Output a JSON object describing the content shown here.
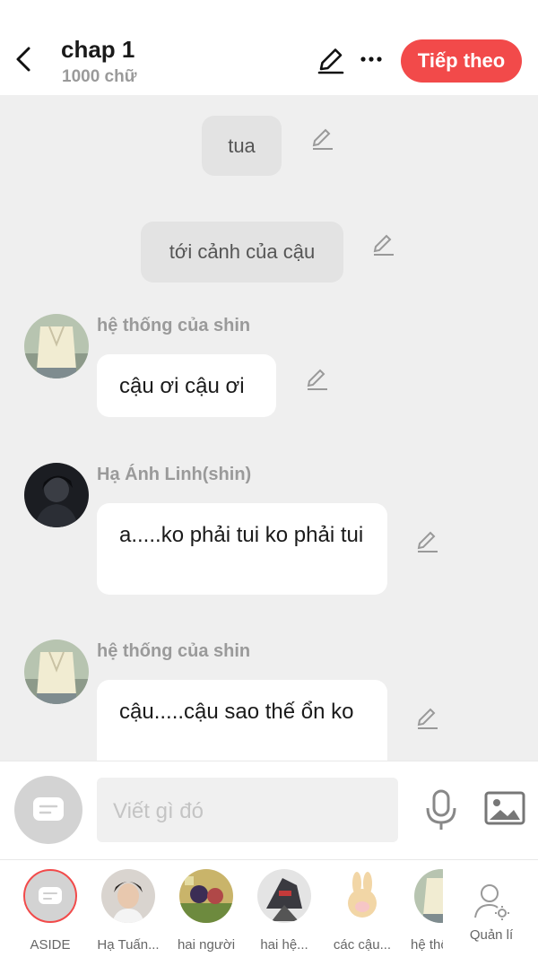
{
  "header": {
    "title": "chap 1",
    "subtitle": "1000 chữ",
    "next_label": "Tiếp theo"
  },
  "messages": [
    {
      "type": "narration",
      "text": "tua"
    },
    {
      "type": "narration",
      "text": "tới cảnh của cậu"
    },
    {
      "type": "message",
      "sender": "hệ thống của shin",
      "text": "cậu ơi cậu ơi"
    },
    {
      "type": "message",
      "sender": "Hạ Ánh Linh(shin)",
      "text": "a.....ko phải tui ko phải tui"
    },
    {
      "type": "message",
      "sender": "hệ thống của shin",
      "text": "cậu.....cậu sao thế ổn ko"
    }
  ],
  "composer": {
    "placeholder": "Viết gì đó"
  },
  "characters": [
    {
      "label": "ASIDE"
    },
    {
      "label": "Hạ Tuấn..."
    },
    {
      "label": "hai người"
    },
    {
      "label": "hai hệ..."
    },
    {
      "label": "các cậu..."
    },
    {
      "label": "hệ thố"
    }
  ],
  "manage_label": "Quản lí",
  "colors": {
    "accent": "#f24a4a",
    "chat_background": "#efefef",
    "narration_background": "#e3e3e3",
    "bubble_background": "#ffffff"
  },
  "icons": [
    "back-arrow-icon",
    "pencil-icon",
    "more-dots-icon",
    "microphone-icon",
    "image-icon",
    "chat-bubble-icon",
    "user-settings-icon"
  ]
}
